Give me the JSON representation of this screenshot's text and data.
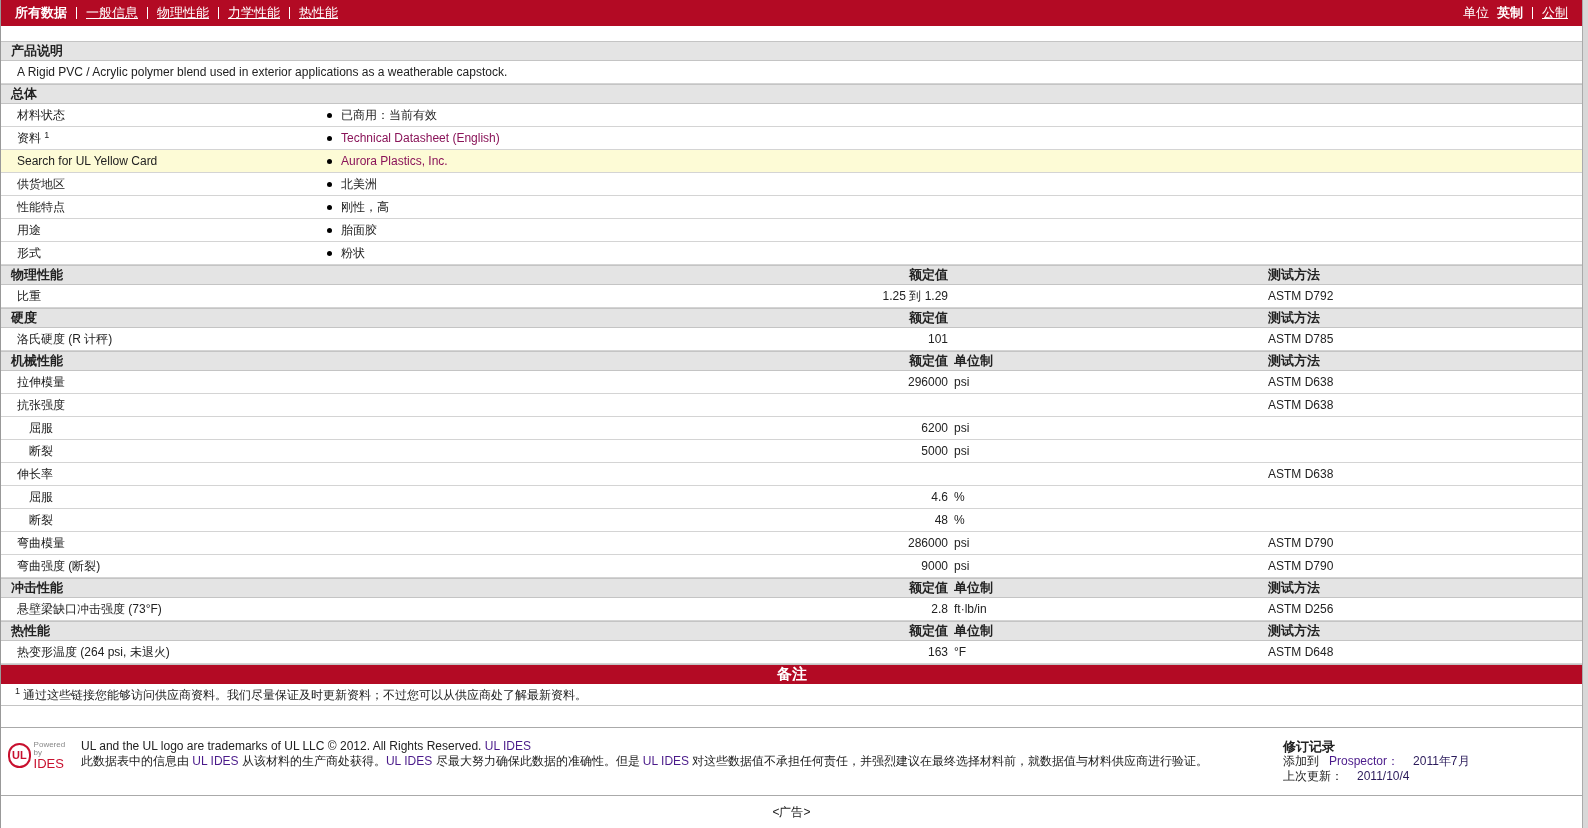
{
  "nav": {
    "tabs": [
      {
        "label": "所有数据",
        "selected": true
      },
      {
        "label": "一般信息",
        "selected": false
      },
      {
        "label": "物理性能",
        "selected": false
      },
      {
        "label": "力学性能",
        "selected": false
      },
      {
        "label": "热性能",
        "selected": false
      }
    ],
    "units_label": "单位",
    "units": [
      {
        "label": "英制",
        "selected": true
      },
      {
        "label": "公制",
        "selected": false
      }
    ]
  },
  "sections": [
    {
      "kind": "description",
      "title": "产品说明",
      "text": "A Rigid PVC / Acrylic polymer blend used in exterior applications as a weatherable capstock."
    },
    {
      "kind": "general",
      "title": "总体",
      "rows": [
        {
          "label": "材料状态",
          "value": "已商用：当前有效",
          "link": false,
          "highlighted": false
        },
        {
          "label": "资料 $^{1}$",
          "value": "Technical Datasheet (English)",
          "link": true,
          "highlighted": false
        },
        {
          "label": "Search for UL Yellow Card",
          "value": "Aurora Plastics, Inc.",
          "link": true,
          "highlighted": true
        },
        {
          "label": "供货地区",
          "value": "北美洲",
          "link": false,
          "highlighted": false
        },
        {
          "label": "性能特点",
          "value": "刚性，高",
          "link": false,
          "highlighted": false
        },
        {
          "label": "用途",
          "value": "胎面胶",
          "link": false,
          "highlighted": false
        },
        {
          "label": "形式",
          "value": "粉状",
          "link": false,
          "highlighted": false
        }
      ]
    },
    {
      "kind": "properties",
      "title": "物理性能",
      "value_header": "额定值",
      "method_header": "测试方法",
      "rows": [
        {
          "label": "比重",
          "value": "1.25 到  1.29",
          "method": "ASTM D792"
        }
      ]
    },
    {
      "kind": "properties",
      "title": "硬度",
      "value_header": "额定值",
      "method_header": "测试方法",
      "rows": [
        {
          "label": "洛氏硬度 (R 计秤)",
          "value": "101",
          "method": "ASTM D785"
        }
      ]
    },
    {
      "kind": "properties",
      "title": "机械性能",
      "value_header": "额定值",
      "unit_header": "单位制",
      "method_header": "测试方法",
      "rows": [
        {
          "label": "拉伸模量",
          "value": "296000",
          "unit": "psi",
          "method": "ASTM D638"
        },
        {
          "label": "抗张强度",
          "method": "ASTM D638",
          "children": [
            {
              "label": "屈服",
              "value": "6200",
              "unit": "psi"
            },
            {
              "label": "断裂",
              "value": "5000",
              "unit": "psi"
            }
          ]
        },
        {
          "label": "伸长率",
          "method": "ASTM D638",
          "children": [
            {
              "label": "屈服",
              "value": "4.6",
              "unit": "%"
            },
            {
              "label": "断裂",
              "value": "48",
              "unit": "%"
            }
          ]
        },
        {
          "label": "弯曲模量",
          "value": "286000",
          "unit": "psi",
          "method": "ASTM D790"
        },
        {
          "label": "弯曲强度 (断裂)",
          "value": "9000",
          "unit": "psi",
          "method": "ASTM D790"
        }
      ]
    },
    {
      "kind": "properties",
      "title": "冲击性能",
      "value_header": "额定值",
      "unit_header": "单位制",
      "method_header": "测试方法",
      "rows": [
        {
          "label": "悬壁梁缺口冲击强度 (73°F)",
          "value": "2.8",
          "unit": "ft·lb/in",
          "method": "ASTM D256"
        }
      ]
    },
    {
      "kind": "properties",
      "title": "热性能",
      "value_header": "额定值",
      "unit_header": "单位制",
      "method_header": "测试方法",
      "rows": [
        {
          "label": "热变形温度 (264 psi, 未退火)",
          "value": "163",
          "unit": "°F",
          "method": "ASTM D648"
        }
      ]
    }
  ],
  "notes": {
    "title": "备注",
    "footnotes": [
      "$^{1}$ 通过这些链接您能够访问供应商资料。我们尽量保证及时更新资料；不过您可以从供应商处了解最新资料。"
    ]
  },
  "footer": {
    "logo": {
      "mark": "UL",
      "caption": "Powered by",
      "name": "IDES"
    },
    "lines": [
      [
        {
          "text": "UL and the UL logo are trademarks of UL LLC © 2012. All Rights Reserved. ",
          "link": false
        },
        {
          "text": "UL IDES",
          "link": true
        }
      ],
      [
        {
          "text": "此数据表中的信息由 ",
          "link": false
        },
        {
          "text": "UL IDES",
          "link": true
        },
        {
          "text": " 从该材料的生产商处获得。",
          "link": false
        },
        {
          "text": "UL IDES",
          "link": true
        },
        {
          "text": " 尽最大努力确保此数据的准确性。但是 ",
          "link": false
        },
        {
          "text": "UL IDES",
          "link": true
        },
        {
          "text": " 对这些数据值不承担任何责任，并强烈建议在最终选择材料前，就数据值与材料供应商进行验证。",
          "link": false
        }
      ]
    ],
    "revision": {
      "title": "修订记录",
      "rows": [
        {
          "label": "添加到",
          "value": "Prospector：",
          "date": "2011年7月"
        },
        {
          "label": "上次更新：",
          "date": "2011/10/4"
        }
      ]
    }
  },
  "ad": "<广告>"
}
